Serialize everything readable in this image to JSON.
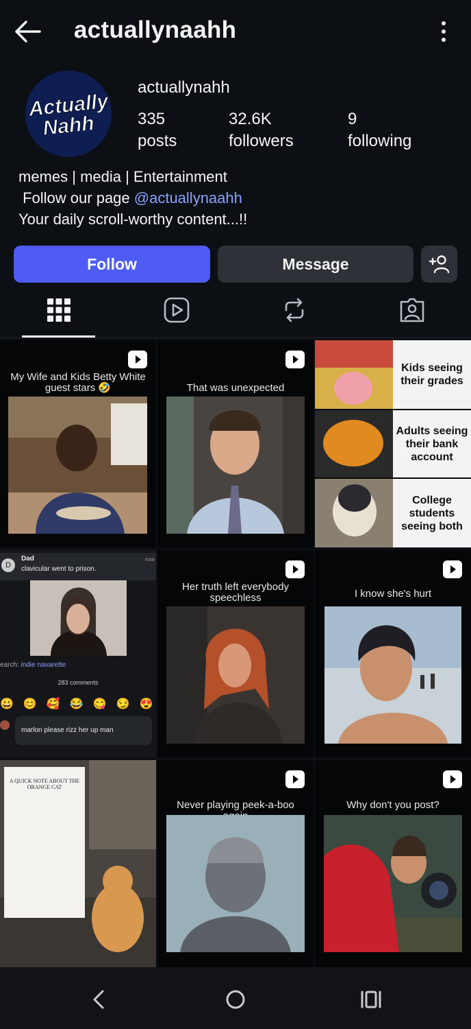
{
  "header": {
    "title": "actuallynaahh"
  },
  "profile": {
    "avatar_text_line1": "Actually",
    "avatar_text_line2": "Nahh",
    "handle": "actuallynahh",
    "stats": [
      {
        "value": "335",
        "label": "posts"
      },
      {
        "value": "32.6K",
        "label": "followers"
      },
      {
        "value": "9",
        "label": "following"
      }
    ],
    "bio_line1": "memes | media | Entertainment",
    "bio_line2_prefix": " Follow our page ",
    "bio_line2_link": "@actuallynaahh",
    "bio_line3": "Your daily scroll-worthy content...!!"
  },
  "actions": {
    "follow": "Follow",
    "message": "Message"
  },
  "tabs": [
    "grid-icon",
    "reels-icon",
    "reposts-icon",
    "tagged-icon"
  ],
  "posts": [
    {
      "caption": "My Wife and Kids Betty White guest stars 🤣"
    },
    {
      "caption": "That was unexpected"
    },
    {
      "panels": [
        "Kids seeing their grades",
        "Adults seeing their bank account",
        "College students seeing both"
      ]
    },
    {
      "chat_name": "Dad",
      "chat_text": "clavicular went to prison.",
      "chat_time": "now",
      "search_prefix": "earch: ",
      "search_term": "indie navarette",
      "comments": "283 comments",
      "reply": "marlon please rizz her up man"
    },
    {
      "caption": "Her truth left everybody speechless"
    },
    {
      "caption": "I know she's hurt"
    },
    {
      "note_title": "A QUICK NOTE ABOUT THE ORANGE CAT"
    },
    {
      "caption": "Never playing peek-a-boo again"
    },
    {
      "caption": "Why don't you post?"
    }
  ],
  "colors": {
    "accent": "#4e5cf5",
    "link": "#8aa2ff",
    "background": "#0c0f14"
  }
}
